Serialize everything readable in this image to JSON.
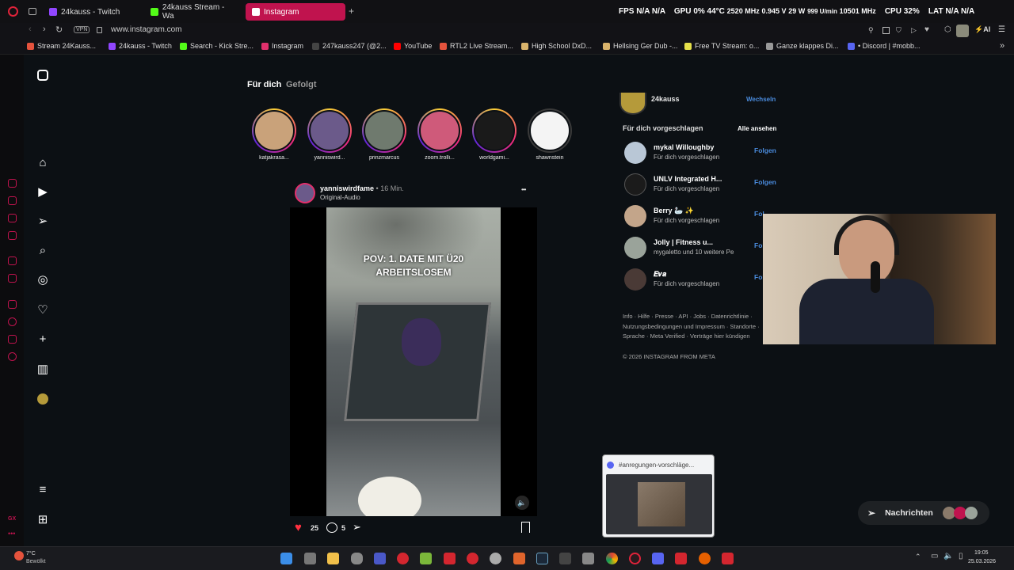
{
  "tabs": [
    {
      "label": "24kauss - Twitch",
      "color": "#9146ff"
    },
    {
      "label": "24kauss Stream - Wa",
      "color": "#53fc18"
    },
    {
      "label": "Instagram",
      "color": "#e1306c"
    }
  ],
  "new_tab": "+",
  "stats": {
    "fps_label": "FPS",
    "fps1": "N/A",
    "fps2": "N/A",
    "gpu_label": "GPU",
    "gpu_pct": "0%",
    "gpu_temp": "44°C",
    "gpu_clock": "2520 MHz",
    "gpu_volt": "0.945 V",
    "gpu_power": "29 W",
    "gpu_fan": "999 U/min",
    "gpu_mem": "10501 MHz",
    "cpu_label": "CPU",
    "cpu_pct": "32%",
    "lat_label": "LAT",
    "lat1": "N/A",
    "lat2": "N/A"
  },
  "address": {
    "vpn": "VPN",
    "url": "www.instagram.com"
  },
  "bookmarks": [
    {
      "label": "Stream 24Kauss...",
      "color": "#e5533d"
    },
    {
      "label": "24kauss - Twitch",
      "color": "#9146ff"
    },
    {
      "label": "Search - Kick Stre...",
      "color": "#53fc18"
    },
    {
      "label": "Instagram",
      "color": "#e1306c"
    },
    {
      "label": "247kauss247 (@2...",
      "color": "#222"
    },
    {
      "label": "YouTube",
      "color": "#ff0000"
    },
    {
      "label": "RTL2 Live Stream...",
      "color": "#e5533d"
    },
    {
      "label": "High School DxD...",
      "color": "#d9b36b"
    },
    {
      "label": "Hellsing Ger Dub -...",
      "color": "#d9b36b"
    },
    {
      "label": "Free TV Stream: o...",
      "color": "#e6e04a"
    },
    {
      "label": "Ganze klappes Di...",
      "color": "#999"
    },
    {
      "label": "• Discord | #mobb...",
      "color": "#5865f2"
    }
  ],
  "feed": {
    "tab_active": "Für dich",
    "tab_inactive": "Gefolgt",
    "stories": [
      {
        "name": "katjakrasa...",
        "color": "#c9a27a",
        "seen": false
      },
      {
        "name": "yanniswird...",
        "color": "#6b5a8a",
        "seen": false
      },
      {
        "name": "prinzmarcus",
        "color": "#6f7a6e",
        "seen": false
      },
      {
        "name": "zoom.trolli...",
        "color": "#cf5a7a",
        "seen": false
      },
      {
        "name": "worldgami...",
        "color": "#1a1a1a",
        "seen": false
      },
      {
        "name": "shawnstein",
        "color": "#f4f4f4",
        "seen": true
      }
    ],
    "post": {
      "author": "yanniswirdfame",
      "dot": "•",
      "time": "16 Min.",
      "audio": "Original-Audio",
      "more": "•••",
      "caption_line1": "POV: 1. DATE MIT Ü20",
      "caption_line2": "ARBEITSLOSEM",
      "likes": "25",
      "comments": "5"
    }
  },
  "right": {
    "account": "24kauss",
    "switch": "Wechseln",
    "suggested_title": "Für dich vorgeschlagen",
    "see_all": "Alle ansehen",
    "suggestions": [
      {
        "name": "mykal Willoughby",
        "sub": "Für dich vorgeschlagen",
        "follow": "Folgen",
        "color": "#b9c7d6"
      },
      {
        "name": "UNLV Integrated H...",
        "sub": "Für dich vorgeschlagen",
        "follow": "Folgen",
        "color": "#1b1b1b"
      },
      {
        "name": "Berry 🦢 ✨",
        "sub": "Für dich vorgeschlagen",
        "follow": "Fol",
        "color": "#c3a58a"
      },
      {
        "name": "Jolly | Fitness u...",
        "sub": "mygaletto und 10 weitere Pe",
        "follow": "Fol",
        "color": "#9aa39a"
      },
      {
        "name": "𝑬𝒗𝒂",
        "sub": "Für dich vorgeschlagen",
        "follow": "Fol",
        "color": "#4a3a36"
      }
    ],
    "footer1": "Info · Hilfe · Presse · API · Jobs · Datenrichtlinie ·",
    "footer2": "Nutzungsbedingungen und Impressum · Standorte ·",
    "footer3": "Sprache · Meta Verified · Verträge hier kündigen",
    "copyright": "© 2026 INSTAGRAM FROM META"
  },
  "messages_button": "Nachrichten",
  "discord_popup": "#anregungen-vorschläge...",
  "taskbar": {
    "weather_temp": "7°C",
    "weather_desc": "Bewölkt",
    "time": "19:05",
    "date": "25.03.2026"
  },
  "colors": {
    "accent": "#c0134e",
    "link": "#4a8bdd",
    "like": "#ff3040"
  }
}
